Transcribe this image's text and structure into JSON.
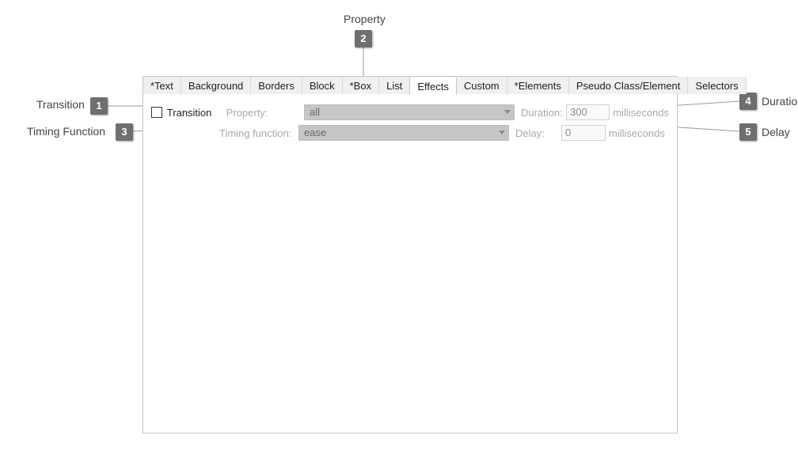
{
  "tabs": {
    "t0": "*Text",
    "t1": "Background",
    "t2": "Borders",
    "t3": "Block",
    "t4": "*Box",
    "t5": "List",
    "t6": "Effects",
    "t7": "Custom",
    "t8": "*Elements",
    "t9": "Pseudo Class/Element",
    "t10": "Selectors"
  },
  "transition": {
    "checkbox_label": "Transition",
    "property_label": "Property:",
    "property_value": "all",
    "duration_label": "Duration:",
    "duration_value": "300",
    "duration_unit": "milliseconds",
    "timing_label": "Timing function:",
    "timing_value": "ease",
    "delay_label": "Delay:",
    "delay_value": "0",
    "delay_unit": "milliseconds"
  },
  "callouts": {
    "c1": {
      "num": "1",
      "label": "Transition"
    },
    "c2": {
      "num": "2",
      "label": "Property"
    },
    "c3": {
      "num": "3",
      "label": "Timing Function"
    },
    "c4": {
      "num": "4",
      "label": "Duration"
    },
    "c5": {
      "num": "5",
      "label": "Delay"
    }
  }
}
